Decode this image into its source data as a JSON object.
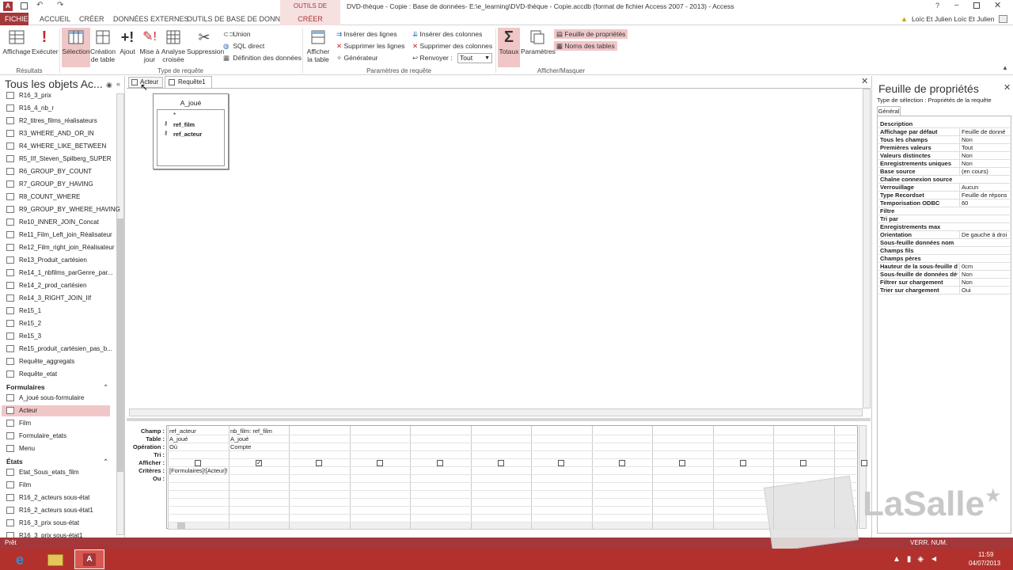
{
  "window": {
    "title": "DVD-thèque - Copie : Base de données- E:\\e_learning\\DVD-thèque - Copie.accdb (format de fichier Access 2007 - 2013) - Access",
    "context_title": "OUTILS DE REQUÊTE",
    "user": "Loïc Et Julien Loïc Et Julien",
    "help": "?"
  },
  "tabs": [
    "FICHIER",
    "ACCUEIL",
    "CRÉER",
    "DONNÉES EXTERNES",
    "OUTILS DE BASE DE DONNÉES",
    "CRÉER"
  ],
  "ribbon": {
    "affichage": "Affichage",
    "executer": "Exécuter",
    "group_resultats": "Résultats",
    "selection": "Sélection",
    "creation_table": "Création de table",
    "ajout": "Ajout",
    "mise_a_jour": "Mise à jour",
    "analyse_croisee": "Analyse croisée",
    "suppression": "Suppression",
    "union": "Union",
    "sql_direct": "SQL direct",
    "definition_donnees": "Définition des données",
    "group_type": "Type de requête",
    "afficher_table": "Afficher la table",
    "inserer_lignes": "Insérer des lignes",
    "supprimer_lignes": "Supprimer les lignes",
    "generateur": "Générateur",
    "inserer_colonnes": "Insérer des colonnes",
    "supprimer_colonnes": "Supprimer des colonnes",
    "renvoyer": "Renvoyer :",
    "renvoyer_value": "Tout",
    "group_parametres": "Paramètres de requête",
    "totaux": "Totaux",
    "parametres": "Paramètres",
    "feuille_proprietes": "Feuille de propriétés",
    "noms_tables": "Noms des tables",
    "group_afficher": "Afficher/Masquer"
  },
  "nav": {
    "title": "Tous les objets Ac...",
    "queries": [
      "R16_3_prix",
      "R16_4_nb_r",
      "R2_titres_films_réalisateurs",
      "R3_WHERE_AND_OR_IN",
      "R4_WHERE_LIKE_BETWEEN",
      "R5_IIf_Steven_Spilberg_SUPER",
      "R6_GROUP_BY_COUNT",
      "R7_GROUP_BY_HAVING",
      "R8_COUNT_WHERE",
      "R9_GROUP_BY_WHERE_HAVING",
      "Re10_INNER_JOIN_Concat",
      "Re11_Film_Left_join_Réalisateur",
      "Re12_Film_right_join_Réalisateur",
      "Re13_Produit_cartésien",
      "Re14_1_nbfilms_parGenre_par...",
      "Re14_2_prod_cartésien",
      "Re14_3_RIGHT_JOIN_IIf",
      "Re15_1",
      "Re15_2",
      "Re15_3",
      "Re15_produit_cartésien_pas_b...",
      "Requête_aggregats",
      "Requête_etat"
    ],
    "section_forms": "Formulaires",
    "forms": [
      "A_joué sous-formulaire",
      "Acteur",
      "Film",
      "Formulaire_etats",
      "Menu"
    ],
    "section_reports": "États",
    "reports": [
      "Etat_Sous_etats_film",
      "Film",
      "R16_2_acteurs sous-état",
      "R16_2_acteurs sous-état1",
      "R16_3_prix sous-état",
      "R16_3_prix sous-état1"
    ]
  },
  "doc_tabs": [
    "Acteur",
    "Requête1"
  ],
  "table_box": {
    "name": "A_joué",
    "fields": [
      "*",
      "ref_film",
      "ref_acteur"
    ]
  },
  "grid": {
    "row_labels": [
      "Champ :",
      "Table :",
      "Opération :",
      "Tri :",
      "Afficher :",
      "Critères :",
      "Ou :"
    ],
    "col1": {
      "champ": "ref_acteur",
      "table": "A_joué",
      "operation": "Où",
      "criteres": "[Formulaires]![Acteur]!"
    },
    "col2": {
      "champ": "nb_film: ref_film",
      "table": "A_joué",
      "operation": "Compte"
    }
  },
  "props": {
    "title": "Feuille de propriétés",
    "selection_type": "Type de sélection : Propriétés de la requête",
    "tab": "Général",
    "rows": [
      [
        "Description",
        ""
      ],
      [
        "Affichage par défaut",
        "Feuille de donné"
      ],
      [
        "Tous les champs",
        "Non"
      ],
      [
        "Premières valeurs",
        "Tout"
      ],
      [
        "Valeurs distinctes",
        "Non"
      ],
      [
        "Enregistrements uniques",
        "Non"
      ],
      [
        "Base source",
        "(en cours)"
      ],
      [
        "Chaîne connexion source",
        ""
      ],
      [
        "Verrouillage",
        "Aucun"
      ],
      [
        "Type Recordset",
        "Feuille de répons"
      ],
      [
        "Temporisation ODBC",
        "60"
      ],
      [
        "Filtre",
        ""
      ],
      [
        "Tri par",
        ""
      ],
      [
        "Enregistrements max",
        ""
      ],
      [
        "Orientation",
        "De gauche à droi"
      ],
      [
        "Sous-feuille données nom",
        ""
      ],
      [
        "Champs fils",
        ""
      ],
      [
        "Champs pères",
        ""
      ],
      [
        "Hauteur de la sous-feuille de",
        "0cm"
      ],
      [
        "Sous-feuille de données dév",
        "Non"
      ],
      [
        "Filtrer sur chargement",
        "Non"
      ],
      [
        "Trier sur chargement",
        "Oui"
      ]
    ]
  },
  "status": {
    "left": "Prêt",
    "right": "VERR. NUM."
  },
  "watermark": "LaSalle",
  "clock": {
    "time": "11:59",
    "date": "04/07/2013"
  },
  "colors": {
    "accent": "#a4373a",
    "ribbon_active": "#f1c6c7"
  }
}
